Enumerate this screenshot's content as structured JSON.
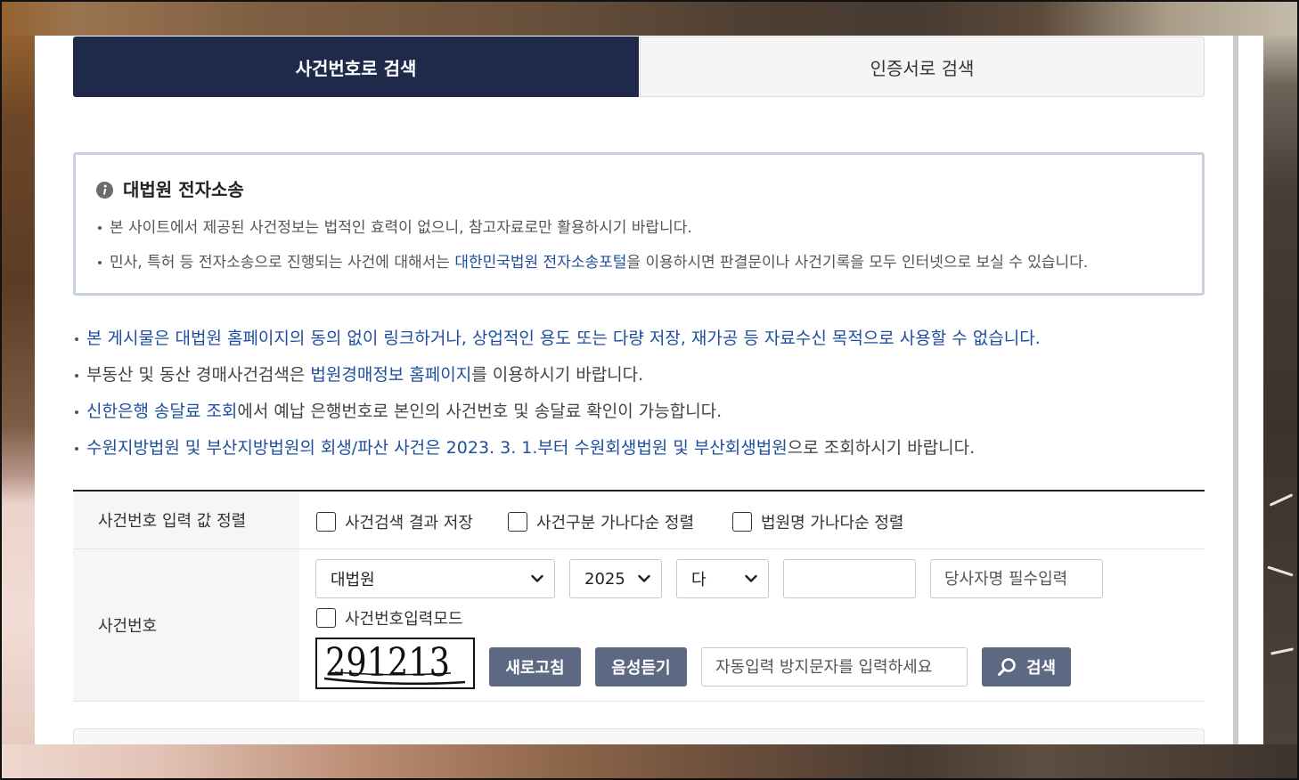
{
  "colors": {
    "tab_active_bg": "#1f2a4a",
    "accent_blue": "#1e4f9d",
    "button_bg": "#5d6983"
  },
  "tabs": [
    {
      "label": "사건번호로 검색",
      "active": true
    },
    {
      "label": "인증서로 검색",
      "active": false
    }
  ],
  "notice": {
    "icon": "info-icon",
    "title": "대법원 전자소송",
    "items": [
      {
        "text": "본 사이트에서 제공된 사건정보는 법적인 효력이 없으니, 참고자료로만 활용하시기 바랍니다."
      },
      {
        "text": "민사, 특허 등 전자소송으로 진행되는 사건에 대해서는 ",
        "link": "대한민국법원 전자소송포털",
        "after": "을 이용하시면 판결문이나 사건기록을 모두 인터넷으로 보실 수 있습니다."
      }
    ]
  },
  "guidelines": [
    {
      "highlight": "본 게시물은 대법원 홈페이지의 동의 없이 링크하거나, 상업적인 용도 또는 다량 저장, 재가공 등 자료수신 목적으로 사용할 수 없습니다."
    },
    {
      "text": "부동산 및 동산 경매사건검색은 ",
      "link": "법원경매정보 홈페이지",
      "after": "를 이용하시기 바랍니다."
    },
    {
      "link": "신한은행 송달료 조회",
      "after": "에서 예납 은행번호로 본인의 사건번호 및 송달료 확인이 가능합니다."
    },
    {
      "highlight": "수원지방법원 및 부산지방법원의 회생/파산 사건은 2023. 3. 1.부터 수원회생법원 및 부산회생법원",
      "after": "으로 조회하시기 바랍니다."
    }
  ],
  "form": {
    "sort_row": {
      "label": "사건번호 입력 값 정렬",
      "options": [
        {
          "label": "사건검색 결과 저장",
          "checked": false
        },
        {
          "label": "사건구분 가나다순 정렬",
          "checked": false
        },
        {
          "label": "법원명 가나다순 정렬",
          "checked": false
        }
      ]
    },
    "case_row": {
      "label": "사건번호",
      "court": {
        "value": "대법원",
        "icon": "chevron-down-icon"
      },
      "year": {
        "value": "2025",
        "icon": "chevron-down-icon"
      },
      "case_type": {
        "value": "다",
        "icon": "chevron-down-icon"
      },
      "case_number": {
        "value": ""
      },
      "party_name": {
        "value": "",
        "placeholder": "당사자명 필수입력"
      },
      "input_mode": {
        "label": "사건번호입력모드",
        "checked": false
      },
      "captcha": {
        "text": "291213"
      },
      "refresh_button": "새로고침",
      "audio_button": "음성듣기",
      "captcha_input": {
        "value": "",
        "placeholder": "자동입력 방지문자를 입력하세요"
      },
      "search_button": {
        "label": "검색",
        "icon": "search-icon"
      }
    }
  }
}
